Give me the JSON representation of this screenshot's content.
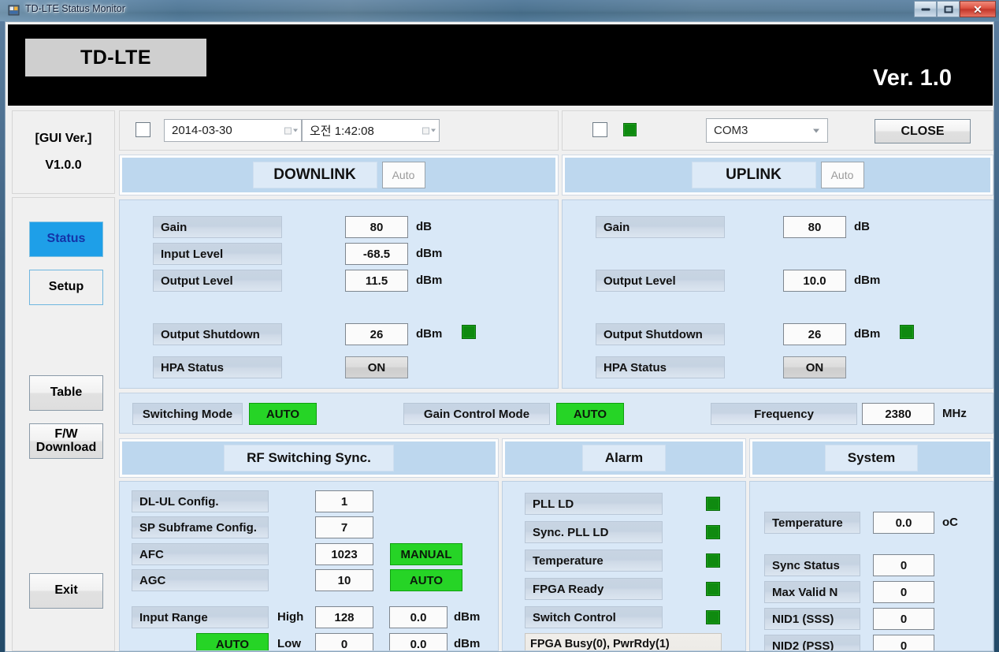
{
  "window": {
    "title": "TD-LTE Status Monitor",
    "minimize_label": "minimize",
    "maximize_label": "maximize",
    "close_label": "✕"
  },
  "banner": {
    "logo": "TD-LTE",
    "version": "Ver. 1.0"
  },
  "sidebar": {
    "gui_ver_label": "[GUI Ver.]",
    "gui_ver_value": "V1.0.0",
    "buttons": [
      {
        "label": "Status",
        "state": "active"
      },
      {
        "label": "Setup",
        "state": "flat"
      },
      {
        "label": "Table",
        "state": "normal"
      },
      {
        "label": "F/W\nDownload",
        "line1": "F/W",
        "line2": "Download",
        "state": "normal"
      },
      {
        "label": "Exit",
        "state": "normal"
      }
    ]
  },
  "toolbar": {
    "date_checkbox_checked": false,
    "date_value": "2014-03-30",
    "time_value": "오전  1:42:08",
    "port_checkbox_checked": false,
    "port_led_color": "#0f8a10",
    "port_value": "COM3",
    "close_label": "CLOSE"
  },
  "downlink": {
    "tab_title": "DOWNLINK",
    "tab_auto": "Auto",
    "rows": [
      {
        "label": "Gain",
        "value": "80",
        "unit": "dB"
      },
      {
        "label": "Input Level",
        "value": "-68.5",
        "unit": "dBm"
      },
      {
        "label": "Output Level",
        "value": "11.5",
        "unit": "dBm"
      },
      {
        "label": "Output Shutdown",
        "value": "26",
        "unit": "dBm",
        "led": true
      },
      {
        "label": "HPA Status",
        "value": "ON",
        "unit": ""
      }
    ]
  },
  "uplink": {
    "tab_title": "UPLINK",
    "tab_auto": "Auto",
    "rows": [
      {
        "label": "Gain",
        "value": "80",
        "unit": "dB"
      },
      {
        "label": "Output Level",
        "value": "10.0",
        "unit": "dBm"
      },
      {
        "label": "Output Shutdown",
        "value": "26",
        "unit": "dBm",
        "led": true
      },
      {
        "label": "HPA Status",
        "value": "ON",
        "unit": ""
      }
    ]
  },
  "modebar": {
    "switching_mode_label": "Switching Mode",
    "switching_mode_value": "AUTO",
    "gain_control_mode_label": "Gain Control Mode",
    "gain_control_mode_value": "AUTO",
    "frequency_label": "Frequency",
    "frequency_value": "2380",
    "frequency_unit": "MHz"
  },
  "rf_sync": {
    "title": "RF Switching Sync.",
    "rows": [
      {
        "label": "DL-UL Config.",
        "value": "1",
        "mode": ""
      },
      {
        "label": "SP Subframe Config.",
        "value": "7",
        "mode": ""
      },
      {
        "label": "AFC",
        "value": "1023",
        "mode": "MANUAL"
      },
      {
        "label": "AGC",
        "value": "10",
        "mode": "AUTO"
      }
    ],
    "input_range_label": "Input Range",
    "input_range_auto": "AUTO",
    "high_label": "High",
    "high_value": "128",
    "high_dbm": "0.0",
    "low_label": "Low",
    "low_value": "0",
    "low_dbm": "0.0",
    "unit": "dBm"
  },
  "alarm": {
    "title": "Alarm",
    "rows": [
      {
        "label": "PLL LD",
        "led": true
      },
      {
        "label": "Sync. PLL LD",
        "led": true
      },
      {
        "label": "Temperature",
        "led": true
      },
      {
        "label": "FPGA Ready",
        "led": true
      },
      {
        "label": "Switch Control",
        "led": true
      }
    ],
    "status_text": "FPGA Busy(0), PwrRdy(1)"
  },
  "system": {
    "title": "System",
    "temperature_label": "Temperature",
    "temperature_value": "0.0",
    "temperature_unit": "oC",
    "rows": [
      {
        "label": "Sync Status",
        "value": "0"
      },
      {
        "label": "Max Valid N",
        "value": "0"
      },
      {
        "label": "NID1 (SSS)",
        "value": "0"
      },
      {
        "label": "NID2 (PSS)",
        "value": "0"
      }
    ]
  },
  "colors": {
    "accent_blue": "#1e9fe8",
    "panel_blue": "#d9e8f7",
    "tab_blue": "#bdd7ee",
    "green_button": "#26d426",
    "green_led": "#0f8a10"
  }
}
